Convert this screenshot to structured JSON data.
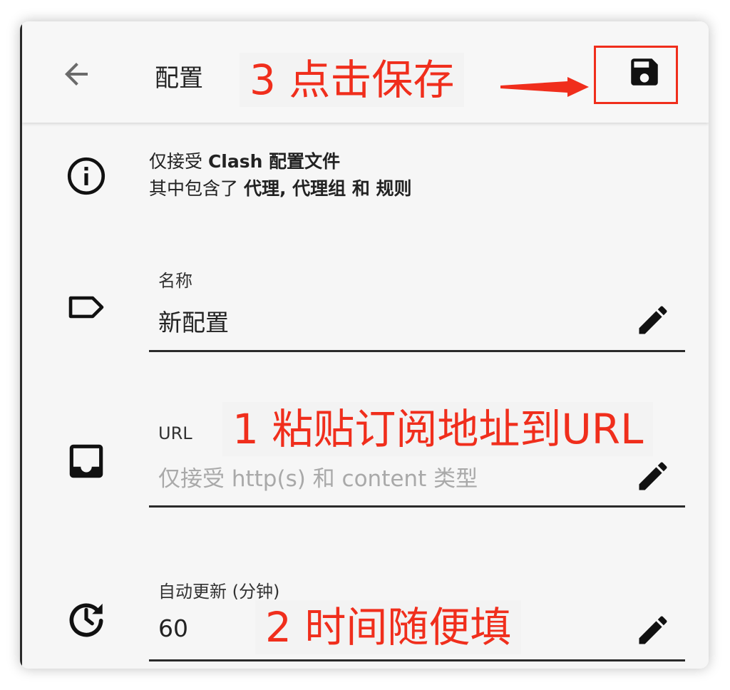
{
  "appbar": {
    "title": "配置",
    "back_icon": "arrow-left-icon",
    "save_icon": "floppy-disk-icon"
  },
  "info": {
    "line1_prefix": "仅接受 ",
    "line1_bold": "Clash 配置文件",
    "line2_prefix": "其中包含了 ",
    "line2_bold": "代理, 代理组 和 规则",
    "icon": "info-circle-icon"
  },
  "fields": {
    "name": {
      "label": "名称",
      "value": "新配置",
      "icon": "tag-icon",
      "edit_icon": "pencil-icon"
    },
    "url": {
      "label": "URL",
      "placeholder": "仅接受 http(s) 和 content 类型",
      "icon": "inbox-icon",
      "edit_icon": "pencil-icon"
    },
    "interval": {
      "label": "自动更新 (分钟)",
      "value": "60",
      "icon": "update-clock-icon",
      "edit_icon": "pencil-icon"
    }
  },
  "annotations": {
    "step3": "3 点击保存",
    "step1": "1 粘贴订阅地址到URL",
    "step2": "2 时间随便填",
    "color": "#f02e1c"
  }
}
